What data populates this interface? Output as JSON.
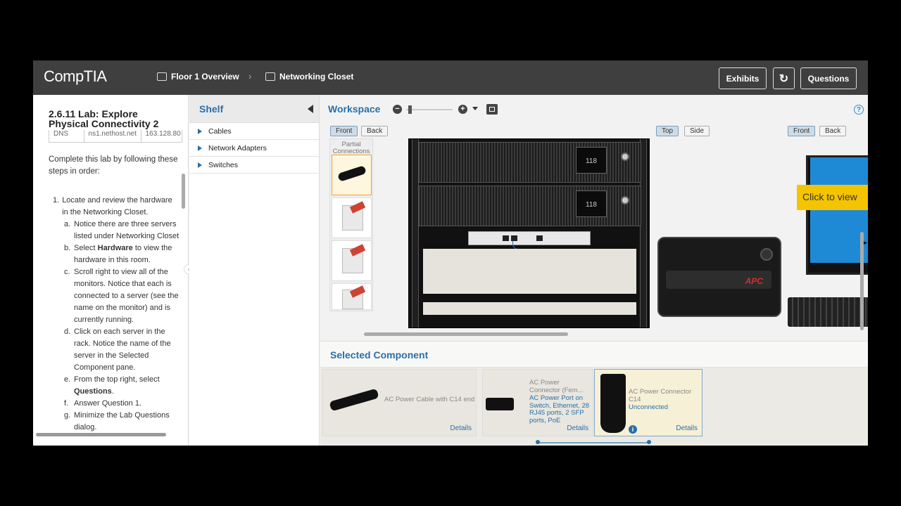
{
  "header": {
    "logo": "CompTIA",
    "breadcrumbs": [
      {
        "label": "Floor 1 Overview",
        "icon": "building-icon"
      },
      {
        "label": "Networking Closet",
        "icon": "monitor-icon"
      }
    ],
    "separator": "›",
    "buttons": {
      "exhibits": "Exhibits",
      "refresh": "↻",
      "questions": "Questions"
    }
  },
  "instructions": {
    "title": "2.6.11 Lab: Explore Physical Connectivity 2",
    "table_row": [
      "DNS",
      "ns1.nethost.net",
      "163.128.80"
    ],
    "intro": "Complete this lab by following these steps in order:",
    "step1": {
      "num": "1.",
      "text": "Locate and review the hardware in the Networking Closet."
    },
    "substeps": [
      {
        "letter": "a.",
        "text": "Notice there are three servers listed under Networking Closet"
      },
      {
        "letter": "b.",
        "pre": "Select ",
        "bold": "Hardware",
        "post": " to view the hardware in this room."
      },
      {
        "letter": "c.",
        "text": "Scroll right to view all of the monitors. Notice that each is connected to a server (see the name on the monitor) and is currently running."
      },
      {
        "letter": "d.",
        "text": "Click on each server in the rack. Notice the name of the server in the Selected Component pane."
      },
      {
        "letter": "e.",
        "pre": "From the top right, select ",
        "bold": "Questions",
        "post": "."
      },
      {
        "letter": "f.",
        "text": "Answer Question 1."
      },
      {
        "letter": "g.",
        "text": "Minimize the Lab Questions dialog."
      }
    ]
  },
  "shelf": {
    "title": "Shelf",
    "items": [
      "Cables",
      "Network Adapters",
      "Switches"
    ]
  },
  "workspace": {
    "title": "Workspace",
    "views": {
      "rack": [
        "Front",
        "Back"
      ],
      "ups": [
        "Top",
        "Side"
      ],
      "monitor": [
        "Front",
        "Back"
      ]
    },
    "partial_label": "Partial Connections",
    "ups_display": "118",
    "apc_brand": "APC",
    "monitor_tooltip": "Click to view"
  },
  "selected": {
    "title": "Selected Component",
    "cards": [
      {
        "name": "AC Power Cable with C14 end",
        "details": "Details"
      },
      {
        "name": "AC Power Connector (Fem...",
        "state": "AC Power Port on Switch, Ethernet, 28 RJ45 ports, 2 SFP ports, PoE",
        "details": "Details"
      },
      {
        "name": "AC Power Connector C14",
        "state": "Unconnected",
        "details": "Details"
      }
    ]
  },
  "colors": {
    "accent": "#2a6fa8",
    "topbar": "#3f3f3f",
    "selected_tile": "#f0a030"
  }
}
